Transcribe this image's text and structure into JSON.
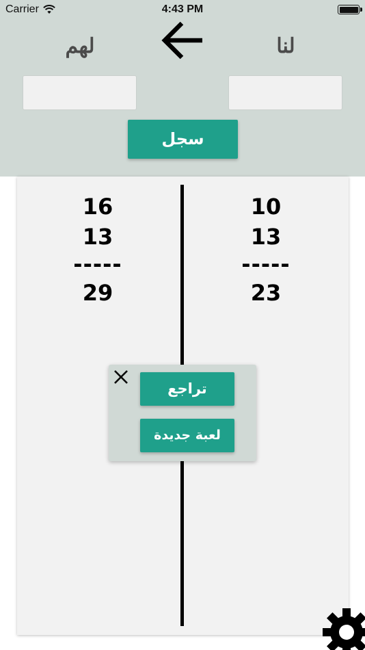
{
  "status_bar": {
    "carrier": "Carrier",
    "time": "4:43 PM",
    "wifi_icon": "wifi-icon",
    "battery_icon": "battery-icon"
  },
  "header": {
    "them_label": "لهم",
    "us_label": "لنا",
    "back_icon": "arrow-left-icon",
    "them_input": {
      "value": "",
      "placeholder": ""
    },
    "us_input": {
      "value": "",
      "placeholder": ""
    },
    "register_label": "سجل",
    "background_color": "#d0d9d5",
    "accent_color": "#1fa08b"
  },
  "scores": {
    "them": {
      "entries": [
        "16",
        "13"
      ],
      "separator": "-----",
      "total": "29"
    },
    "us": {
      "entries": [
        "10",
        "13"
      ],
      "separator": "-----",
      "total": "23"
    }
  },
  "popup": {
    "close_icon": "close-icon",
    "undo_label": "تراجع",
    "new_game_label": "لعبة جديدة"
  },
  "settings_icon": "gear-icon"
}
